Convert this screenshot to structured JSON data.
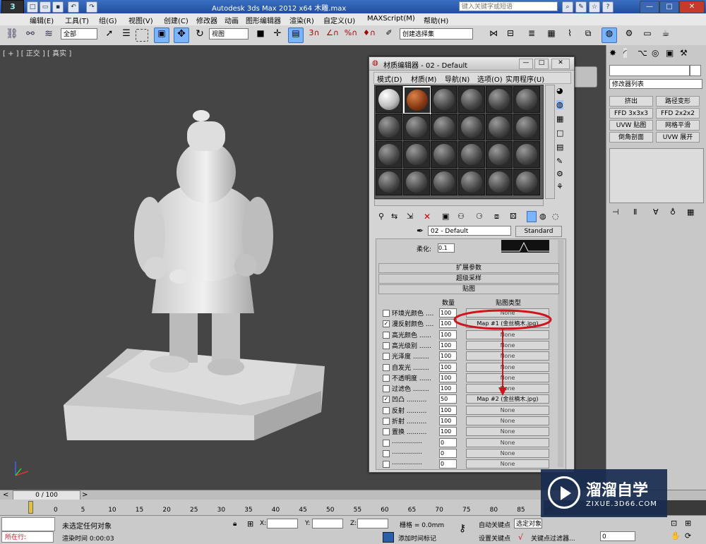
{
  "window": {
    "title": "Autodesk 3ds Max  2012 x64     木雕.max",
    "search_placeholder": "键入关键字或短语",
    "controls": [
      "—",
      "□",
      "✕"
    ]
  },
  "menubar": [
    "编辑(E)",
    "工具(T)",
    "组(G)",
    "视图(V)",
    "创建(C)",
    "修改器",
    "动画",
    "图形编辑器",
    "渲染(R)",
    "自定义(U)",
    "MAXScript(M)",
    "帮助(H)"
  ],
  "toolbar": {
    "filter_selected": "全部",
    "ref_coord": "视图",
    "selection_set": "创建选择集"
  },
  "viewport": {
    "label": "[ + ] [ 正交 ] [ 真实 ]"
  },
  "material_editor": {
    "title": "材质编辑器 - 02 - Default",
    "menu": [
      "模式(D)",
      "材质(M)",
      "导航(N)",
      "选项(O)",
      "实用程序(U)"
    ],
    "material_name": "02 - Default",
    "material_type": "Standard",
    "soften_label": "柔化:",
    "soften_value": "0.1",
    "rollouts": [
      "扩展参数",
      "超级采样",
      "贴图"
    ],
    "maps_header": {
      "amount": "数量",
      "map_type": "贴图类型"
    },
    "maps": [
      {
        "checked": false,
        "label": "环境光颜色 ....",
        "amount": "100",
        "map": "None"
      },
      {
        "checked": true,
        "label": "漫反射颜色 ....",
        "amount": "100",
        "map": "Map #1 (金丝楠木.jpg)"
      },
      {
        "checked": false,
        "label": "高光颜色 ......",
        "amount": "100",
        "map": "None"
      },
      {
        "checked": false,
        "label": "高光级别 ......",
        "amount": "100",
        "map": "None"
      },
      {
        "checked": false,
        "label": "光泽度 ........",
        "amount": "100",
        "map": "None"
      },
      {
        "checked": false,
        "label": "自发光 ........",
        "amount": "100",
        "map": "None"
      },
      {
        "checked": false,
        "label": "不透明度 ......",
        "amount": "100",
        "map": "None"
      },
      {
        "checked": false,
        "label": "过滤色 ........",
        "amount": "100",
        "map": "None"
      },
      {
        "checked": true,
        "label": "凹凸 ..........",
        "amount": "50",
        "map": "Map #2 (金丝楠木.jpg)"
      },
      {
        "checked": false,
        "label": "反射 ..........",
        "amount": "100",
        "map": "None"
      },
      {
        "checked": false,
        "label": "折射 ..........",
        "amount": "100",
        "map": "None"
      },
      {
        "checked": false,
        "label": "置换 ..........",
        "amount": "100",
        "map": "None"
      },
      {
        "checked": false,
        "label": "...............",
        "amount": "0",
        "map": "None"
      },
      {
        "checked": false,
        "label": "...............",
        "amount": "0",
        "map": "None"
      },
      {
        "checked": false,
        "label": "...............",
        "amount": "0",
        "map": "None"
      }
    ]
  },
  "command_panel": {
    "modifier_list": "修改器列表",
    "buttons": [
      "挤出",
      "路径变形",
      "FFD 3x3x3",
      "FFD 2x2x2",
      "UVW 贴图",
      "网格平滑",
      "倒角剖面",
      "UVW 展开"
    ]
  },
  "timeline": {
    "frame": "0 / 100",
    "ticks": [
      "0",
      "5",
      "10",
      "15",
      "20",
      "25",
      "30",
      "35",
      "40",
      "45",
      "50",
      "55",
      "60",
      "65",
      "70",
      "75",
      "80",
      "85",
      "90"
    ]
  },
  "status": {
    "script_label": "所在行:",
    "message": "未选定任何对象",
    "render_time": "渲染时间  0:00:03",
    "add_time_tag": "添加时间标记",
    "x_label": "X:",
    "y_label": "Y:",
    "z_label": "Z:",
    "grid": "栅格 = 0.0mm",
    "auto_key": "自动关键点",
    "selected": "选定对象",
    "set_key": "设置关键点",
    "key_filters": "关键点过滤器...",
    "frame_value": "0"
  },
  "watermark": {
    "brand": "溜溜自学",
    "url": "ZIXUE.3D66.COM"
  },
  "colors": {
    "highlight_red": "#d0141e",
    "title_blue": "#1f4f9e",
    "viewport_bg": "#454545"
  }
}
